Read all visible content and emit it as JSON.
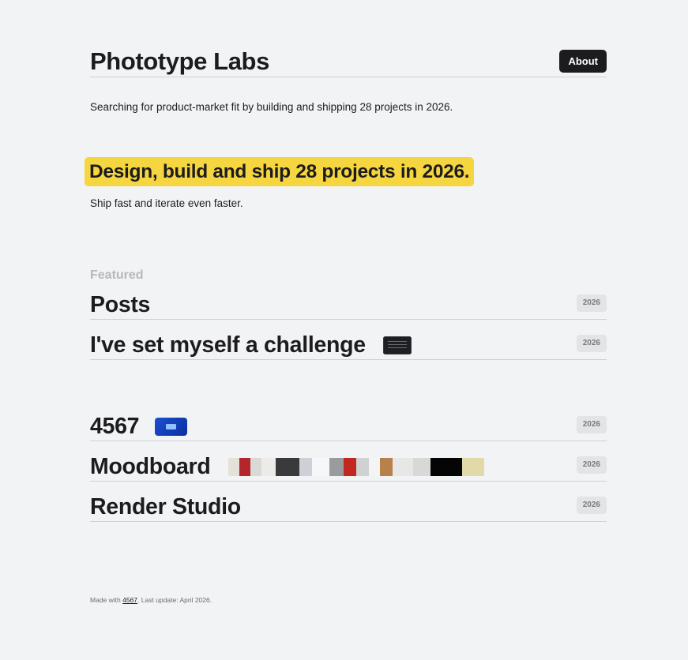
{
  "header": {
    "brand": "Phototype Labs",
    "about_label": "About"
  },
  "intro": "Searching for product-market fit by building and shipping 28 projects in 2026.",
  "hero": {
    "title": "Design, build and ship 28 projects in 2026.",
    "subtitle": "Ship fast and iterate even faster."
  },
  "featured_label": "Featured",
  "rows": [
    {
      "title": "Posts",
      "year": "2026"
    },
    {
      "title": "I've set myself a challenge",
      "year": "2026"
    },
    {
      "title": "4567",
      "year": "2026"
    },
    {
      "title": "Moodboard",
      "year": "2026"
    },
    {
      "title": "Render Studio",
      "year": "2026"
    }
  ],
  "footer": {
    "prefix": "Made with",
    "link": "4567",
    "suffix": ". Last update: April 2026."
  },
  "colors": {
    "accent": "#f6d640",
    "dark": "#1c1c1e",
    "background": "#f2f3f5"
  }
}
